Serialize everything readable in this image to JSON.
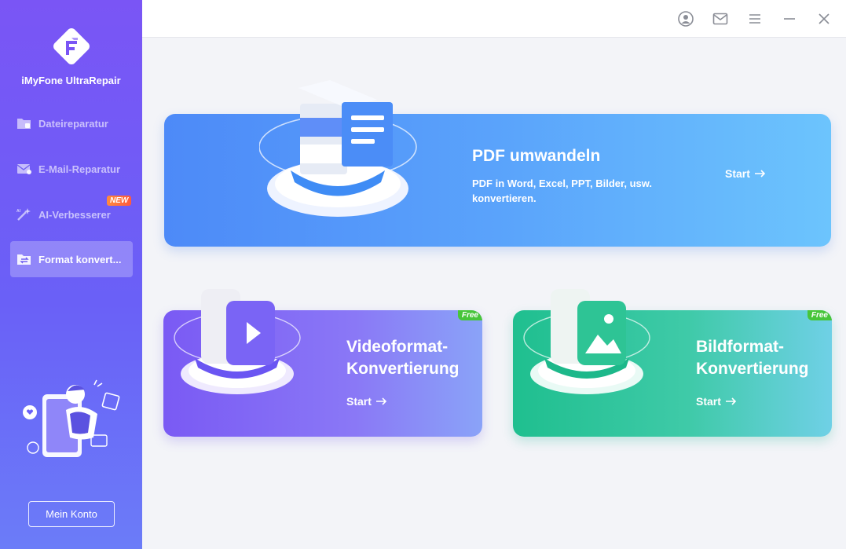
{
  "app": {
    "name": "iMyFone UltraRepair"
  },
  "sidebar": {
    "items": [
      {
        "label": "Dateireparatur",
        "icon": "folder-repair-icon"
      },
      {
        "label": "E-Mail-Reparatur",
        "icon": "mail-repair-icon"
      },
      {
        "label": "AI-Verbesserer",
        "icon": "magic-wand-icon",
        "badge": "NEW"
      },
      {
        "label": "Format konvert...",
        "icon": "format-convert-icon",
        "active": true
      }
    ],
    "account_button": "Mein Konto"
  },
  "titlebar": {
    "icons": [
      "user-icon",
      "mail-icon",
      "menu-icon",
      "minimize-icon",
      "close-icon"
    ]
  },
  "cards": {
    "pdf": {
      "title": "PDF umwandeln",
      "desc_line1": "PDF in Word, Excel, PPT, Bilder, usw.",
      "desc_line2": "konvertieren.",
      "start": "Start"
    },
    "video": {
      "title_line1": "Videoformat-",
      "title_line2": "Konvertierung",
      "start": "Start",
      "badge": "Free"
    },
    "image": {
      "title_line1": "Bildformat-",
      "title_line2": "Konvertierung",
      "start": "Start",
      "badge": "Free"
    }
  },
  "colors": {
    "sidebar_top": "#7a55f5",
    "sidebar_bottom": "#6b7cf8",
    "pdf_card": "#5aa3fb",
    "video_card": "#8a78f6",
    "image_card": "#3fcaa8",
    "free_badge": "#47c53a",
    "new_badge": "#ff6a3d"
  }
}
